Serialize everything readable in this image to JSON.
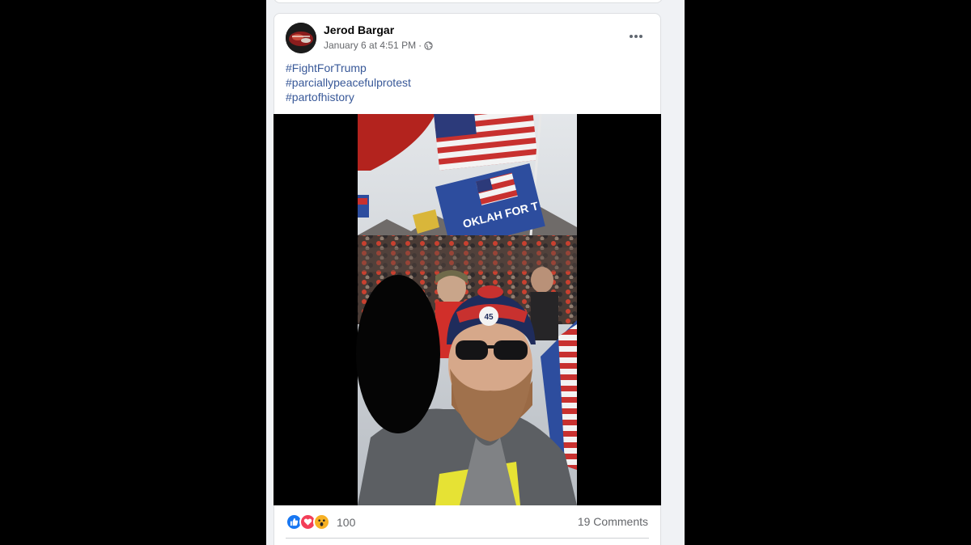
{
  "post": {
    "author": "Jerod Bargar",
    "timestamp": "January 6 at 4:51 PM",
    "separator": "·",
    "privacy_icon": "globe-icon",
    "more_icon": "ellipsis-icon",
    "hashtags": [
      "#FightForTrump",
      "#parciallypeacefulprotest",
      "#partofhistory"
    ],
    "media": {
      "type": "video-still",
      "flag_text": "OKLAH FOR T",
      "hat_badge": "45"
    },
    "reactions": {
      "icons": [
        "like-icon",
        "love-icon",
        "wow-icon"
      ],
      "count": "100"
    },
    "comments_label": "19 Comments"
  },
  "colors": {
    "link": "#385898",
    "secondary_text": "#65676b",
    "like_blue": "#1877f2",
    "love_red": "#f33e58",
    "wow_yellow": "#f7b125"
  }
}
